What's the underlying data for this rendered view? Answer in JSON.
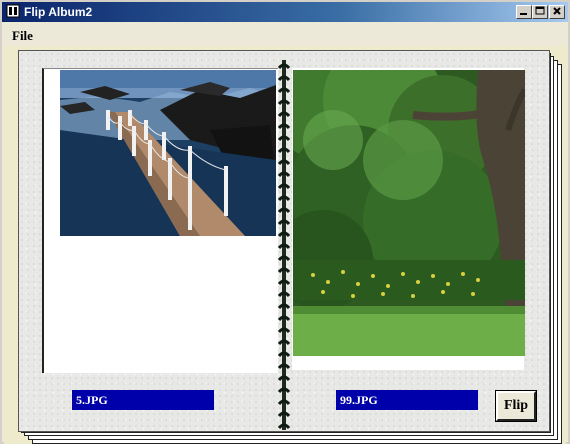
{
  "window": {
    "title": "Flip Album2"
  },
  "menu": {
    "items": [
      "File"
    ]
  },
  "album": {
    "left_caption": "5.JPG",
    "right_caption": "99.JPG",
    "flip_label": "Flip"
  },
  "icons": {
    "app": "album-icon",
    "minimize": "minimize-icon",
    "maximize": "maximize-icon",
    "close": "close-icon"
  },
  "colors": {
    "caption_bg": "#0000aa",
    "title_bar": "#0a246a"
  }
}
